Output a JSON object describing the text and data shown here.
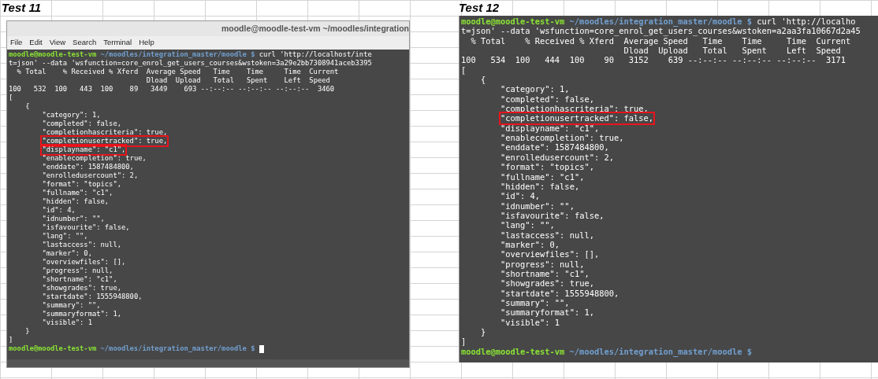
{
  "panels": [
    {
      "label": "Test 11",
      "window": {
        "title": "moodle@moodle-test-vm ~/moodles/integration",
        "menu": [
          "File",
          "Edit",
          "View",
          "Search",
          "Terminal",
          "Help"
        ]
      },
      "lines": [
        {
          "kind": "prompt",
          "user": "moodle@moodle-test-vm",
          "path": "~/moodles/integration_master/moodle $",
          "command": "curl 'http://localhost/inte",
          "cursor": false
        },
        {
          "kind": "output",
          "text": "t=json' --data 'wsfunction=core_enrol_get_users_courses&wstoken=3a29e2bb7308941aceb3395",
          "highlighted": false
        },
        {
          "kind": "output",
          "text": "  % Total    % Received % Xferd  Average Speed   Time    Time     Time  Current",
          "highlighted": false
        },
        {
          "kind": "output",
          "text": "                                 Dload  Upload   Total   Spent    Left  Speed",
          "highlighted": false
        },
        {
          "kind": "output",
          "text": "100   532  100   443  100    89   3449    693 --:--:-- --:--:-- --:--:--  3460",
          "highlighted": false
        },
        {
          "kind": "output",
          "text": "[",
          "highlighted": false
        },
        {
          "kind": "output",
          "text": "    {",
          "highlighted": false
        },
        {
          "kind": "output",
          "text": "        \"category\": 1,",
          "highlighted": false
        },
        {
          "kind": "output",
          "text": "        \"completed\": false,",
          "highlighted": false
        },
        {
          "kind": "output",
          "text": "        \"completionhascriteria\": true,",
          "highlighted": false
        },
        {
          "kind": "output",
          "text": "        \"completionusertracked\": true,",
          "highlighted": true
        },
        {
          "kind": "output",
          "text": "        \"displayname\": \"c1\",",
          "highlighted": true
        },
        {
          "kind": "output",
          "text": "        \"enablecompletion\": true,",
          "highlighted": false
        },
        {
          "kind": "output",
          "text": "        \"enddate\": 1587484800,",
          "highlighted": false
        },
        {
          "kind": "output",
          "text": "        \"enrolledusercount\": 2,",
          "highlighted": false
        },
        {
          "kind": "output",
          "text": "        \"format\": \"topics\",",
          "highlighted": false
        },
        {
          "kind": "output",
          "text": "        \"fullname\": \"c1\",",
          "highlighted": false
        },
        {
          "kind": "output",
          "text": "        \"hidden\": false,",
          "highlighted": false
        },
        {
          "kind": "output",
          "text": "        \"id\": 4,",
          "highlighted": false
        },
        {
          "kind": "output",
          "text": "        \"idnumber\": \"\",",
          "highlighted": false
        },
        {
          "kind": "output",
          "text": "        \"isfavourite\": false,",
          "highlighted": false
        },
        {
          "kind": "output",
          "text": "        \"lang\": \"\",",
          "highlighted": false
        },
        {
          "kind": "output",
          "text": "        \"lastaccess\": null,",
          "highlighted": false
        },
        {
          "kind": "output",
          "text": "        \"marker\": 0,",
          "highlighted": false
        },
        {
          "kind": "output",
          "text": "        \"overviewfiles\": [],",
          "highlighted": false
        },
        {
          "kind": "output",
          "text": "        \"progress\": null,",
          "highlighted": false
        },
        {
          "kind": "output",
          "text": "        \"shortname\": \"c1\",",
          "highlighted": false
        },
        {
          "kind": "output",
          "text": "        \"showgrades\": true,",
          "highlighted": false
        },
        {
          "kind": "output",
          "text": "        \"startdate\": 1555948800,",
          "highlighted": false
        },
        {
          "kind": "output",
          "text": "        \"summary\": \"\",",
          "highlighted": false
        },
        {
          "kind": "output",
          "text": "        \"summaryformat\": 1,",
          "highlighted": false
        },
        {
          "kind": "output",
          "text": "        \"visible\": 1",
          "highlighted": false
        },
        {
          "kind": "output",
          "text": "    }",
          "highlighted": false
        },
        {
          "kind": "output",
          "text": "]",
          "highlighted": false
        },
        {
          "kind": "prompt",
          "user": "moodle@moodle-test-vm",
          "path": "~/moodles/integration_master/moodle $",
          "cursor": true
        }
      ]
    },
    {
      "label": "Test 12",
      "lines": [
        {
          "kind": "prompt",
          "user": "moodle@moodle-test-vm",
          "path": "~/moodles/integration_master/moodle $",
          "command": "curl 'http://localho",
          "cursor": false
        },
        {
          "kind": "output",
          "text": "t=json' --data 'wsfunction=core_enrol_get_users_courses&wstoken=a2aa3fa10667d2a45",
          "highlighted": false
        },
        {
          "kind": "output",
          "text": "  % Total    % Received % Xferd  Average Speed   Time    Time     Time  Current",
          "highlighted": false
        },
        {
          "kind": "output",
          "text": "                                 Dload  Upload   Total   Spent    Left  Speed",
          "highlighted": false
        },
        {
          "kind": "output",
          "text": "100   534  100   444  100    90   3152    639 --:--:-- --:--:-- --:--:--  3171",
          "highlighted": false
        },
        {
          "kind": "output",
          "text": "[",
          "highlighted": false
        },
        {
          "kind": "output",
          "text": "    {",
          "highlighted": false
        },
        {
          "kind": "output",
          "text": "        \"category\": 1,",
          "highlighted": false
        },
        {
          "kind": "output",
          "text": "        \"completed\": false,",
          "highlighted": false
        },
        {
          "kind": "output",
          "text": "        \"completionhascriteria\": true,",
          "highlighted": false
        },
        {
          "kind": "output",
          "text": "        \"completionusertracked\": false,",
          "highlighted": true
        },
        {
          "kind": "output",
          "text": "        \"displayname\": \"c1\",",
          "highlighted": false
        },
        {
          "kind": "output",
          "text": "        \"enablecompletion\": true,",
          "highlighted": false
        },
        {
          "kind": "output",
          "text": "        \"enddate\": 1587484800,",
          "highlighted": false
        },
        {
          "kind": "output",
          "text": "        \"enrolledusercount\": 2,",
          "highlighted": false
        },
        {
          "kind": "output",
          "text": "        \"format\": \"topics\",",
          "highlighted": false
        },
        {
          "kind": "output",
          "text": "        \"fullname\": \"c1\",",
          "highlighted": false
        },
        {
          "kind": "output",
          "text": "        \"hidden\": false,",
          "highlighted": false
        },
        {
          "kind": "output",
          "text": "        \"id\": 4,",
          "highlighted": false
        },
        {
          "kind": "output",
          "text": "        \"idnumber\": \"\",",
          "highlighted": false
        },
        {
          "kind": "output",
          "text": "        \"isfavourite\": false,",
          "highlighted": false
        },
        {
          "kind": "output",
          "text": "        \"lang\": \"\",",
          "highlighted": false
        },
        {
          "kind": "output",
          "text": "        \"lastaccess\": null,",
          "highlighted": false
        },
        {
          "kind": "output",
          "text": "        \"marker\": 0,",
          "highlighted": false
        },
        {
          "kind": "output",
          "text": "        \"overviewfiles\": [],",
          "highlighted": false
        },
        {
          "kind": "output",
          "text": "        \"progress\": null,",
          "highlighted": false
        },
        {
          "kind": "output",
          "text": "        \"shortname\": \"c1\",",
          "highlighted": false
        },
        {
          "kind": "output",
          "text": "        \"showgrades\": true,",
          "highlighted": false
        },
        {
          "kind": "output",
          "text": "        \"startdate\": 1555948800,",
          "highlighted": false
        },
        {
          "kind": "output",
          "text": "        \"summary\": \"\",",
          "highlighted": false
        },
        {
          "kind": "output",
          "text": "        \"summaryformat\": 1,",
          "highlighted": false
        },
        {
          "kind": "output",
          "text": "        \"visible\": 1",
          "highlighted": false
        },
        {
          "kind": "output",
          "text": "    }",
          "highlighted": false
        },
        {
          "kind": "output",
          "text": "]",
          "highlighted": false
        },
        {
          "kind": "prompt",
          "user": "moodle@moodle-test-vm",
          "path": "~/moodles/integration_master/moodle $",
          "cursor": false
        }
      ]
    }
  ]
}
